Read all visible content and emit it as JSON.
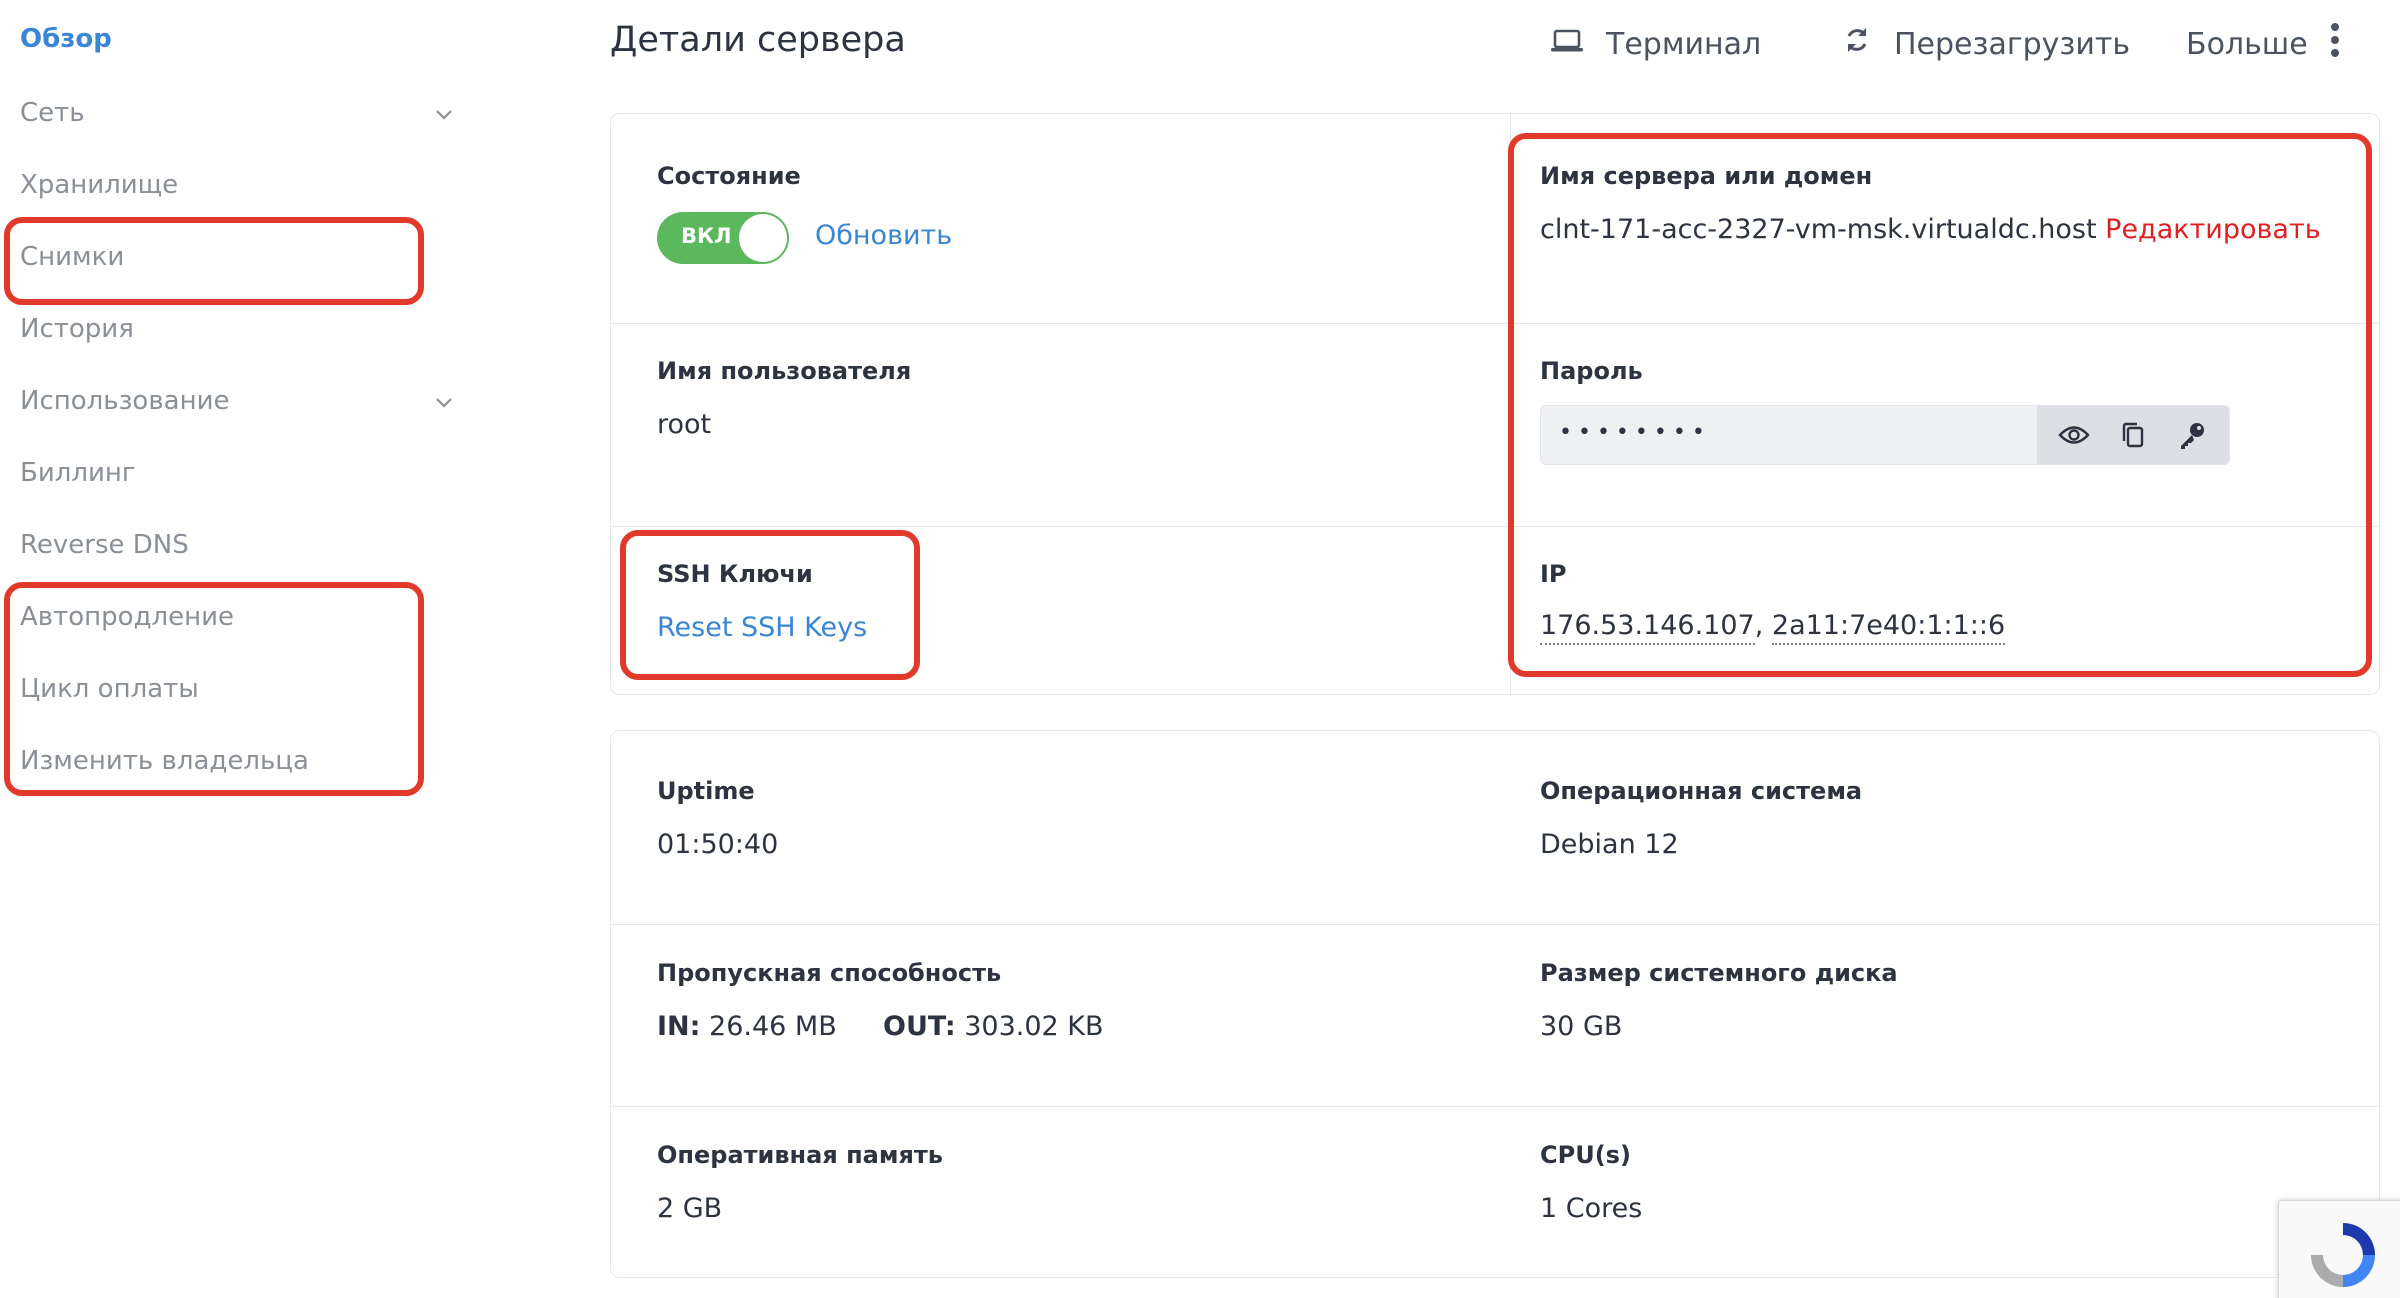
{
  "sidebar": {
    "items": [
      {
        "label": "Обзор"
      },
      {
        "label": "Сеть"
      },
      {
        "label": "Хранилище"
      },
      {
        "label": "Снимки"
      },
      {
        "label": "История"
      },
      {
        "label": "Использование"
      },
      {
        "label": "Биллинг"
      },
      {
        "label": "Reverse DNS"
      },
      {
        "label": "Автопродление"
      },
      {
        "label": "Цикл оплаты"
      },
      {
        "label": "Изменить владельца"
      }
    ]
  },
  "header": {
    "title": "Детали сервера",
    "terminal_label": "Терминал",
    "reboot_label": "Перезагрузить",
    "more_label": "Больше"
  },
  "details": {
    "state": {
      "label": "Состояние",
      "toggle_text": "ВКЛ",
      "refresh_label": "Обновить"
    },
    "hostname": {
      "label": "Имя сервера или домен",
      "value": "clnt-171-acc-2327-vm-msk.virtualdc.host",
      "edit_label": "Редактировать"
    },
    "username": {
      "label": "Имя пользователя",
      "value": "root"
    },
    "password": {
      "label": "Пароль",
      "masked": "••••••••"
    },
    "ssh": {
      "label": "SSH Ключи",
      "reset_label": "Reset SSH Keys"
    },
    "ip": {
      "label": "IP",
      "ipv4": "176.53.146.107",
      "separator": ",",
      "ipv6": "2a11:7e40:1:1::6"
    }
  },
  "stats": {
    "uptime": {
      "label": "Uptime",
      "value": "01:50:40"
    },
    "os": {
      "label": "Операционная система",
      "value": "Debian 12"
    },
    "bandwidth": {
      "label": "Пропускная способность",
      "in_label": "IN:",
      "in_value": "26.46 MB",
      "out_label": "OUT:",
      "out_value": "303.02 KB"
    },
    "disk": {
      "label": "Размер системного диска",
      "value": "30 GB"
    },
    "ram": {
      "label": "Оперативная память",
      "value": "2 GB"
    },
    "cpu": {
      "label": "CPU(s)",
      "value": "1 Cores"
    }
  },
  "colors": {
    "accent": "#3a86d6",
    "toggle_on": "#5cb85c",
    "edit_link": "#e02020",
    "highlight": "#e13a2a"
  }
}
